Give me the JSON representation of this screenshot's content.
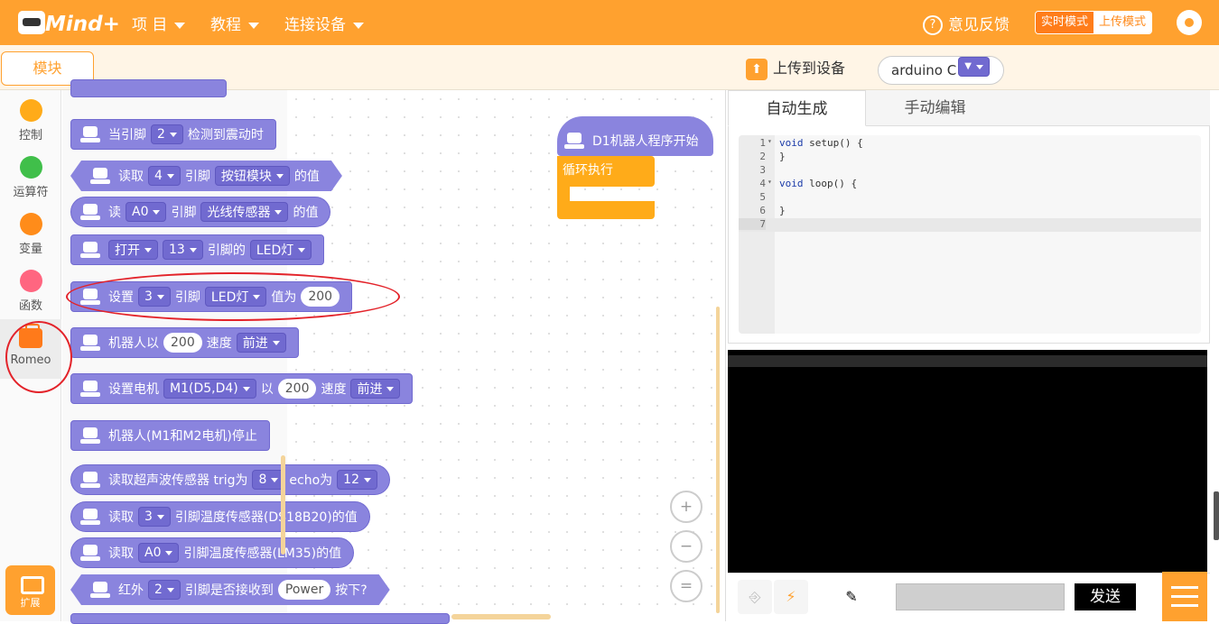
{
  "app": {
    "logo_text": "Mind+"
  },
  "menu": [
    {
      "label": "项 目"
    },
    {
      "label": "教程"
    },
    {
      "label": "连接设备"
    }
  ],
  "topbar": {
    "feedback": "意见反馈",
    "mode_realtime": "实时模式",
    "mode_upload": "上传模式"
  },
  "toolbar": {
    "modules_tab": "模块",
    "upload_label": "上传到设备",
    "board_value": "arduino C"
  },
  "categories": [
    {
      "label": "控制",
      "color": "#ffab19"
    },
    {
      "label": "运算符",
      "color": "#40bf4a"
    },
    {
      "label": "变量",
      "color": "#ff8c1a"
    },
    {
      "label": "函数",
      "color": "#ff6680"
    },
    {
      "label": "Romeo",
      "color": "#ff7a1a"
    }
  ],
  "extension": {
    "label": "扩展"
  },
  "blocks": {
    "b1": {
      "t1": "当引脚",
      "pin": "2",
      "t2": "检测到震动时"
    },
    "b2": {
      "t1": "读取",
      "pin": "4",
      "t2": "引脚",
      "module": "按钮模块",
      "t3": "的值"
    },
    "b3": {
      "t1": "读",
      "pin": "A0",
      "t2": "引脚",
      "module": "光线传感器",
      "t3": "的值"
    },
    "b4": {
      "action": "打开",
      "pin": "13",
      "t1": "引脚的",
      "module": "LED灯"
    },
    "b5": {
      "t1": "设置",
      "pin": "3",
      "t2": "引脚",
      "module": "LED灯",
      "t3": "值为",
      "value": "200"
    },
    "b6": {
      "t1": "机器人以",
      "speed": "200",
      "t2": "速度",
      "dir": "前进"
    },
    "b7": {
      "t1": "设置电机",
      "motor": "M1(D5,D4)",
      "t2": "以",
      "speed": "200",
      "t3": "速度",
      "dir": "前进"
    },
    "b8": {
      "t1": "机器人(M1和M2电机)停止"
    },
    "b9": {
      "t1": "读取超声波传感器 trig为",
      "trig": "8",
      "t2": "echo为",
      "echo": "12"
    },
    "b10": {
      "t1": "读取",
      "pin": "3",
      "t2": "引脚温度传感器(DS18B20)的值"
    },
    "b11": {
      "t1": "读取",
      "pin": "A0",
      "t2": "引脚温度传感器(LM35)的值"
    },
    "b12": {
      "t1": "红外",
      "pin": "2",
      "t2": "引脚是否接收到",
      "key": "Power",
      "t3": "按下?"
    }
  },
  "workspace": {
    "hat_label": "D1机器人程序开始",
    "loop_label": "循环执行",
    "zoom_in": "+",
    "zoom_out": "−",
    "zoom_reset": "="
  },
  "code_tabs": {
    "auto": "自动生成",
    "manual": "手动编辑"
  },
  "code_lines": [
    {
      "n": "1",
      "fold": "▾",
      "kw": "void",
      "rest": " setup() {"
    },
    {
      "n": "2",
      "fold": "",
      "kw": "",
      "rest": "}"
    },
    {
      "n": "3",
      "fold": "",
      "kw": "",
      "rest": ""
    },
    {
      "n": "4",
      "fold": "▾",
      "kw": "void",
      "rest": " loop() {"
    },
    {
      "n": "5",
      "fold": "",
      "kw": "",
      "rest": ""
    },
    {
      "n": "6",
      "fold": "",
      "kw": "",
      "rest": "}"
    },
    {
      "n": "7",
      "fold": "",
      "kw": "",
      "rest": ""
    }
  ],
  "serial": {
    "send_label": "发送",
    "input_value": ""
  }
}
